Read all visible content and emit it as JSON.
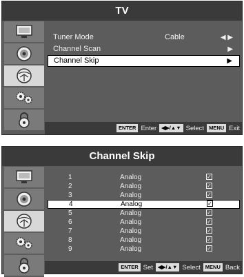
{
  "menu1": {
    "title": "TV",
    "items": [
      {
        "label": "Tuner Mode",
        "value": "Cable",
        "arrow": "◀ ▶"
      },
      {
        "label": "Channel Scan",
        "value": "",
        "arrow": "▶"
      },
      {
        "label": "Channel Skip",
        "value": "",
        "arrow": "▶"
      }
    ],
    "footer": {
      "enter_key": "ENTER",
      "enter_label": "Enter",
      "nav_key": "◀▶/▲▼",
      "nav_label": "Select",
      "menu_key": "MENU",
      "menu_label": "Exit"
    }
  },
  "menu2": {
    "title": "Channel Skip",
    "channels": [
      {
        "num": "1",
        "type": "Analog",
        "checked": "✓"
      },
      {
        "num": "2",
        "type": "Analog",
        "checked": "✓"
      },
      {
        "num": "3",
        "type": "Analog",
        "checked": "✓"
      },
      {
        "num": "4",
        "type": "Analog",
        "checked": "✓"
      },
      {
        "num": "5",
        "type": "Analog",
        "checked": "✓"
      },
      {
        "num": "6",
        "type": "Analog",
        "checked": "✓"
      },
      {
        "num": "7",
        "type": "Analog",
        "checked": "✓"
      },
      {
        "num": "8",
        "type": "Analog",
        "checked": "✓"
      },
      {
        "num": "9",
        "type": "Analog",
        "checked": "✓"
      }
    ],
    "footer": {
      "enter_key": "ENTER",
      "enter_label": "Set",
      "nav_key": "◀▶/▲▼",
      "nav_label": "Select",
      "menu_key": "MENU",
      "menu_label": "Back"
    }
  },
  "sidebar_icons": [
    "picture-icon",
    "sound-icon",
    "channel-icon",
    "setup-icon",
    "lock-icon"
  ]
}
